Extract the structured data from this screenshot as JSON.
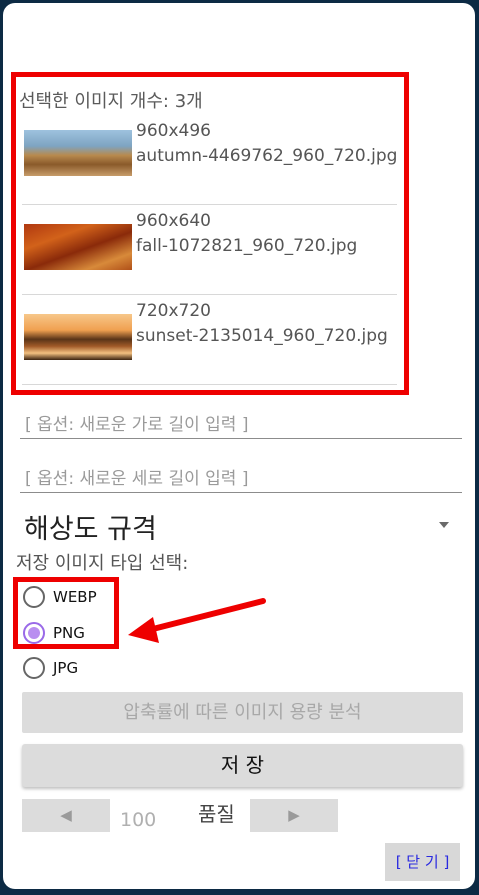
{
  "selected_images": {
    "count_label": "선택한 이미지 개수: 3개",
    "items": [
      {
        "size": "960x496",
        "filename": "autumn-4469762_960_720.jpg"
      },
      {
        "size": "960x640",
        "filename": "fall-1072821_960_720.jpg"
      },
      {
        "size": "720x720",
        "filename": "sunset-2135014_960_720.jpg"
      }
    ]
  },
  "width_input": {
    "placeholder": "[ 옵션: 새로운 가로 길이 입력 ]"
  },
  "height_input": {
    "placeholder": "[ 옵션: 새로운 세로 길이 입력 ]"
  },
  "resolution_spinner": {
    "value": "해상도 규격"
  },
  "save_type": {
    "label": "저장 이미지 타입 선택:",
    "options": [
      {
        "label": "WEBP",
        "checked": false
      },
      {
        "label": "PNG",
        "checked": true
      },
      {
        "label": "JPG",
        "checked": false
      }
    ]
  },
  "analyze_button": {
    "label": "압축률에 따른 이미지 용량 분석"
  },
  "save_button": {
    "label": "저 장"
  },
  "quality": {
    "decrease": "◀",
    "value": "100",
    "label": "품질",
    "increase": "▶"
  },
  "close_button": {
    "label": "[ 닫 기 ]"
  },
  "colors": {
    "annotation_red": "#ee0000",
    "radio_accent": "#b98ef0",
    "close_text": "#2a2ae0"
  }
}
